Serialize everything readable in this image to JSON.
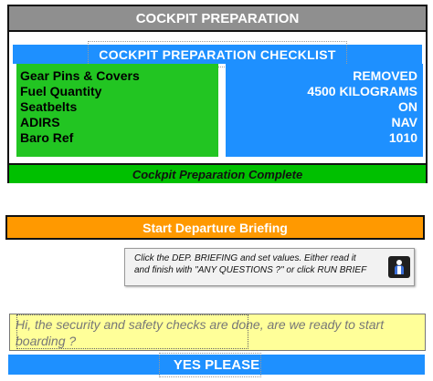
{
  "panel": {
    "title": "COCKPIT PREPARATION",
    "checklist_title": "COCKPIT PREPARATION CHECKLIST",
    "items": [
      {
        "label": "Gear Pins & Covers",
        "value": "REMOVED"
      },
      {
        "label": "Fuel Quantity",
        "value": "4500 KILOGRAMS"
      },
      {
        "label": "Seatbelts",
        "value": "ON"
      },
      {
        "label": "ADIRS",
        "value": "NAV"
      },
      {
        "label": "Baro Ref",
        "value": "1010"
      }
    ],
    "complete_label": "Cockpit Preparation Complete"
  },
  "departure": {
    "button_label": "Start Departure Briefing"
  },
  "note": {
    "text": "Click the DEP. BRIEFING and set values. Either read it and finish with \"ANY QUESTIONS ?\" or click RUN BRIEF",
    "icon": "run-brief-icon"
  },
  "question": {
    "text": "Hi, the security and safety checks are done, are we ready to start boarding ?"
  },
  "yes": {
    "button_label": "YES PLEASE"
  },
  "colors": {
    "title_bar": "#8f8f8f",
    "checklist_blue": "#1e90ff",
    "item_green": "#22c522",
    "complete_green": "#00c000",
    "departure_orange": "#ff9900",
    "question_yellow": "#ffff99"
  }
}
